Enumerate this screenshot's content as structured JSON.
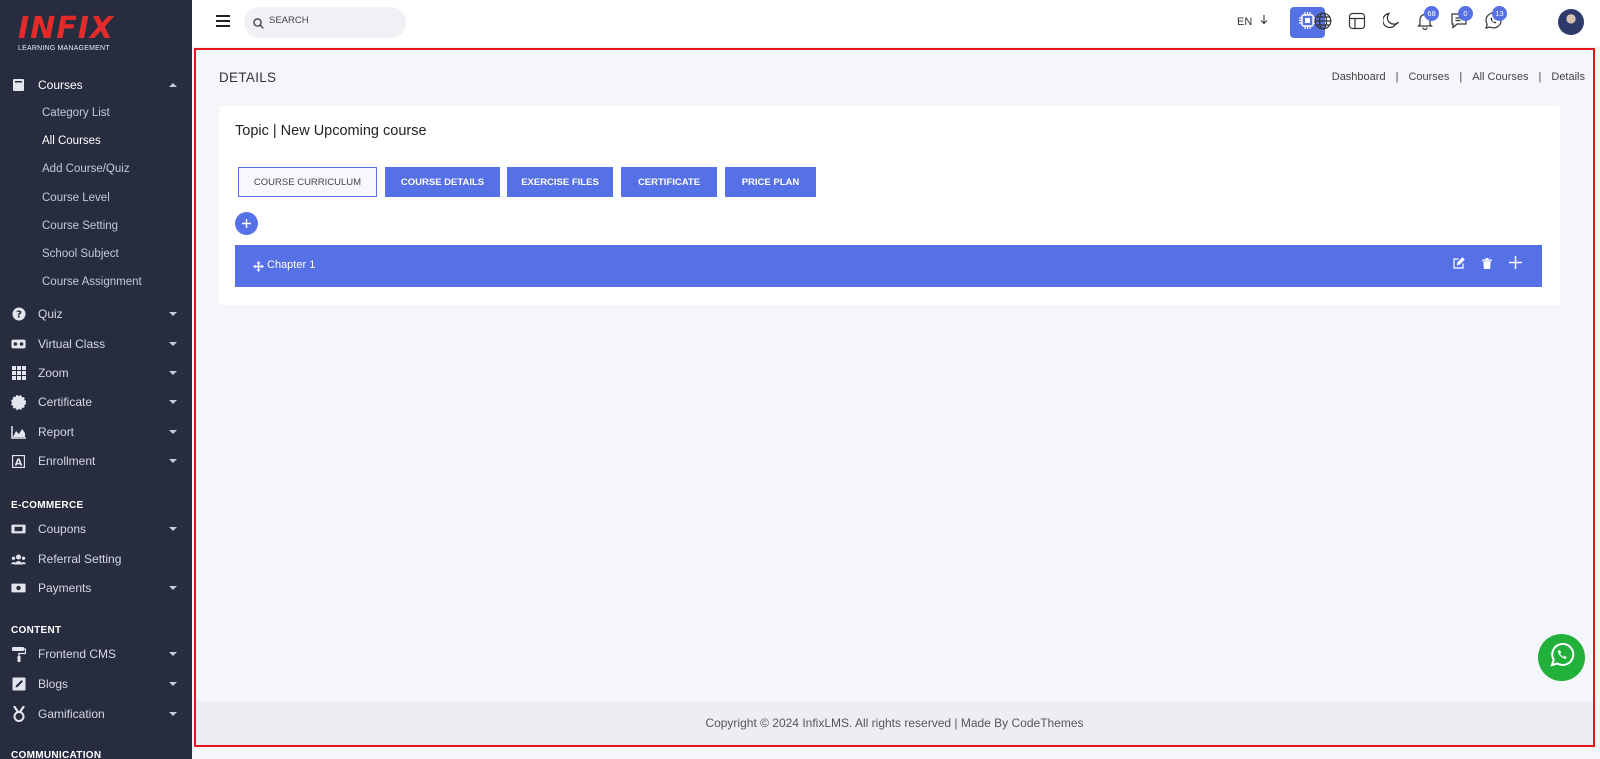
{
  "brand": {
    "name": "INFIX",
    "tagline": "LEARNING MANAGEMENT",
    "color": "#e32b2b"
  },
  "sidebar": {
    "courses_label": "Courses",
    "courses_sub": [
      "Category List",
      "All Courses",
      "Add Course/Quiz",
      "Course Level",
      "Course Setting",
      "School Subject",
      "Course Assignment"
    ],
    "items": [
      "Quiz",
      "Virtual Class",
      "Zoom",
      "Certificate",
      "Report",
      "Enrollment"
    ],
    "section_ecommerce": "E-COMMERCE",
    "ecommerce_items": [
      "Coupons",
      "Referral Setting",
      "Payments"
    ],
    "section_content": "CONTENT",
    "content_items": [
      "Frontend CMS",
      "Blogs",
      "Gamification"
    ],
    "section_communication": "COMMUNICATION"
  },
  "topbar": {
    "search_placeholder": "SEARCH",
    "language": "EN",
    "notification_count": "68",
    "message_count": "0",
    "whatsapp_count": "13"
  },
  "page": {
    "title": "DETAILS",
    "breadcrumb": [
      "Dashboard",
      "Courses",
      "All Courses",
      "Details"
    ],
    "card_title": "Topic | New Upcoming course",
    "tabs": [
      "COURSE CURRICULUM",
      "COURSE DETAILS",
      "EXERCISE FILES",
      "CERTIFICATE",
      "PRICE PLAN"
    ],
    "chapter_label": "Chapter 1",
    "footer": "Copyright © 2024 InfixLMS. All rights reserved | Made By CodeThemes"
  },
  "colors": {
    "accent": "#5670e5",
    "sidebar_bg": "#272d3f",
    "whatsapp": "#21b13a",
    "frame": "#e6141c"
  }
}
